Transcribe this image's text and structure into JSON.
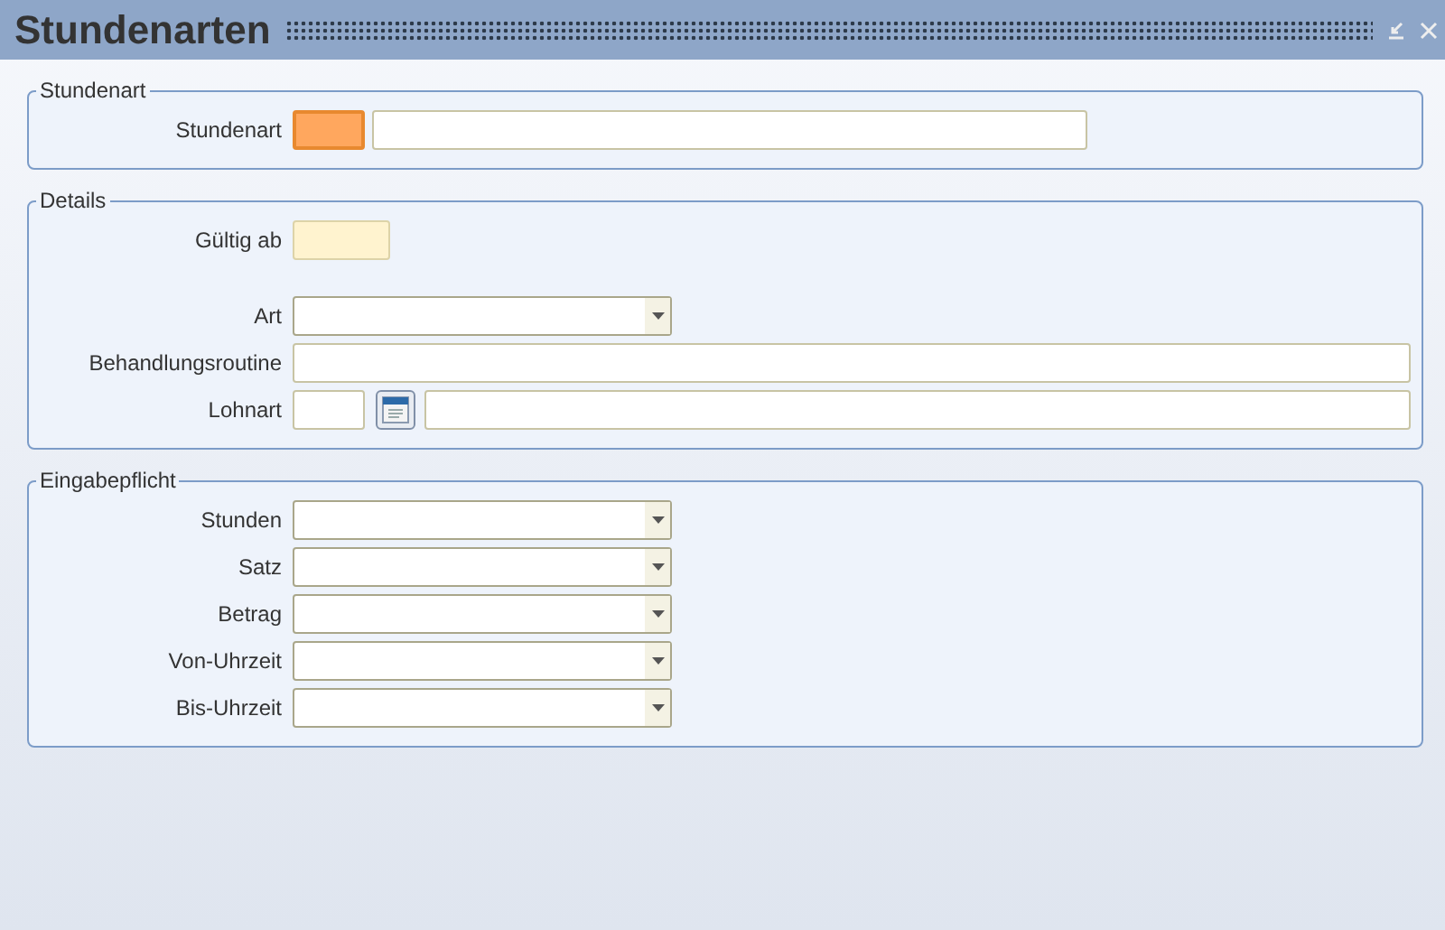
{
  "window": {
    "title": "Stundenarten"
  },
  "groups": [
    {
      "title": "Stundenart",
      "sections": [
        {
          "rows": [
            {
              "label": "Stundenart",
              "fields": [
                {
                  "kind": "code",
                  "focused": true
                },
                {
                  "kind": "name",
                  "focused": false
                }
              ]
            }
          ]
        }
      ]
    },
    {
      "title": "Details",
      "sections": [
        {
          "rows": [
            {
              "label": "Gültig ab",
              "fields": [
                {
                  "kind": "date",
                  "focused": false
                }
              ]
            }
          ]
        },
        {
          "rows": [
            {
              "label": "Art",
              "fields": [
                {
                  "kind": "select",
                  "focused": false
                }
              ]
            },
            {
              "label": "Behandlungsroutine",
              "fields": [
                {
                  "kind": "text",
                  "focused": false
                }
              ]
            },
            {
              "label": "Lohnart",
              "fields": [
                {
                  "kind": "code",
                  "focused": false
                },
                {
                  "kind": "lookup",
                  "focused": false
                },
                {
                  "kind": "text",
                  "focused": false
                }
              ]
            }
          ]
        }
      ]
    },
    {
      "title": "Eingabepflicht",
      "sections": [
        {
          "rows": [
            {
              "label": "Stunden",
              "fields": [
                {
                  "kind": "select",
                  "focused": false
                }
              ]
            },
            {
              "label": "Satz",
              "fields": [
                {
                  "kind": "select",
                  "focused": false
                }
              ]
            },
            {
              "label": "Betrag",
              "fields": [
                {
                  "kind": "select",
                  "focused": false
                }
              ]
            },
            {
              "label": "Von-Uhrzeit",
              "fields": [
                {
                  "kind": "select",
                  "focused": false
                }
              ]
            },
            {
              "label": "Bis-Uhrzeit",
              "fields": [
                {
                  "kind": "select",
                  "focused": false
                }
              ]
            }
          ]
        }
      ]
    }
  ]
}
